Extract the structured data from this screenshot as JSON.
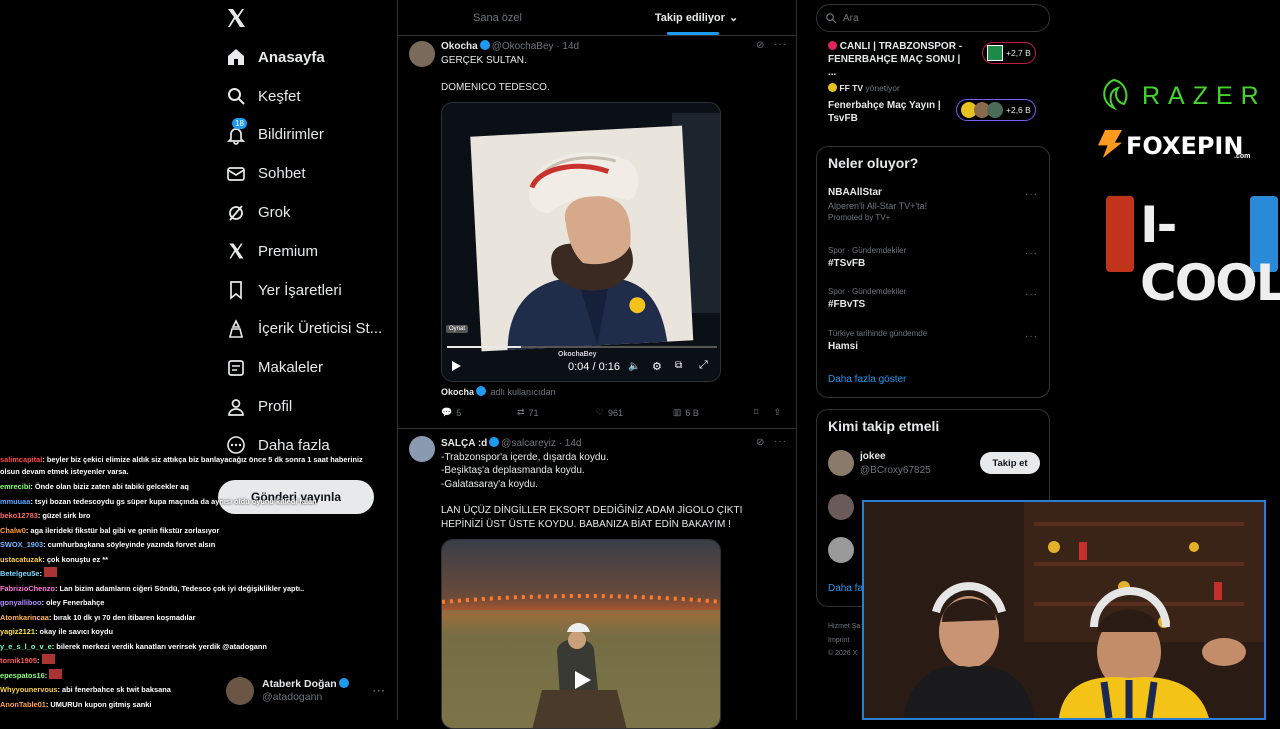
{
  "nav": {
    "items": [
      {
        "label": "Anasayfa",
        "icon": "home-icon"
      },
      {
        "label": "Keşfet",
        "icon": "search-icon"
      },
      {
        "label": "Bildirimler",
        "icon": "bell-icon",
        "badge": "18"
      },
      {
        "label": "Sohbet",
        "icon": "mail-icon"
      },
      {
        "label": "Grok",
        "icon": "grok-icon"
      },
      {
        "label": "Premium",
        "icon": "x-icon"
      },
      {
        "label": "Yer İşaretleri",
        "icon": "bookmark-icon"
      },
      {
        "label": "İçerik Üreticisi St...",
        "icon": "creator-studio-icon"
      },
      {
        "label": "Makaleler",
        "icon": "articles-icon"
      },
      {
        "label": "Profil",
        "icon": "user-icon"
      },
      {
        "label": "Daha fazla",
        "icon": "more-icon"
      }
    ],
    "post_button": "Gönderi yayınla",
    "account": {
      "name": "Ataberk Doğan",
      "handle": "@atadogann"
    }
  },
  "chat": [
    {
      "user": "salimcapital",
      "color": "#ff4a4a",
      "text": ": beyler biz çekici elimize aldık siz attıkça biz banlayacağız önce 5 dk sonra 1 saat haberiniz olsun devam etmek isteyenler varsa."
    },
    {
      "user": "emrecibi",
      "color": "#8cff7a",
      "text": ": Önde olan biziz zaten abi tabiki gelcekler aq"
    },
    {
      "user": "mmuuaa",
      "color": "#5fa8ff",
      "text": ": tsyi bozan tedescoydu gs süper kupa maçında da aynısı oldu oyunu kitledi falan"
    },
    {
      "user": "beko12783",
      "color": "#ff6a6a",
      "text": ": güzel sirk bro"
    },
    {
      "user": "Chalw0",
      "color": "#ff9f40",
      "text": ": aga ilerideki fikstür bal gibi ve genin fikstür zorlasıyor"
    },
    {
      "user": "SWOX_1903",
      "color": "#7ab8ff",
      "text": ": cumhurbaşkana söyleyinde yazında forvet alsın"
    },
    {
      "user": "ustacatuzak",
      "color": "#ffd24a",
      "text": ": çok konuştu ez **"
    },
    {
      "user": "Betelgeu5e",
      "color": "#7ad7ff",
      "text": ":"
    },
    {
      "user": "FabrizioChenzo",
      "color": "#ff7ad7",
      "text": ": Lan bizim adamların ciğeri Söndü, Tedesco çok iyi değişiklikler yaptı.."
    },
    {
      "user": "gonyalliboo",
      "color": "#b58cff",
      "text": ": oley Fenerbahçe"
    },
    {
      "user": "Atomkarincaa",
      "color": "#ffb84a",
      "text": ": bırak 10 dk yı 70 den itibaren koşmadılar"
    },
    {
      "user": "yagiz2121",
      "color": "#ffe14a",
      "text": ": okay ile savıcı koydu"
    },
    {
      "user": "y_e_s_l_o_v_e",
      "color": "#7affc4",
      "text": ": bilerek merkezi verdik kanatları verirsek yerdik @atadogann"
    },
    {
      "user": "tornik1905",
      "color": "#ff5a5a",
      "text": ":"
    },
    {
      "user": "epespatos16",
      "color": "#8cff7a",
      "text": ":"
    },
    {
      "user": "Whyyounervous",
      "color": "#ffd24a",
      "text": ": abi fenerbahce sk twit baksana"
    },
    {
      "user": "AnonTable01",
      "color": "#ffa24a",
      "text": ": UMURUn kupon gitmiş sanki"
    }
  ],
  "feed": {
    "tabs": [
      "Sana özel",
      "Takip ediliyor"
    ],
    "tweet1": {
      "name": "Okocha",
      "handle": "@OkochaBey",
      "time": "· 14d",
      "text1": "GERÇEK SULTAN.",
      "text2": "DOMENICO TEDESCO.",
      "video": {
        "watermark": "OkochaBey",
        "time": "0:04 / 0:16",
        "play_tooltip": "Oynat"
      },
      "source_name": "Okocha",
      "source_note": "adlı kullanıcıdan",
      "replies": "5",
      "reposts": "71",
      "likes": "961",
      "views": "6 B"
    },
    "tweet2": {
      "name": "SALÇA :d",
      "handle": "@salcareyiz",
      "time": "· 14d",
      "lines": [
        "-Trabzonspor'a içerde, dışarda koydu.",
        "-Beşiktaş'a deplasmanda koydu.",
        "-Galatasaray'a koydu."
      ],
      "text2": "LAN ÜÇÜZ DİNGİLLER EKSORT DEDİĞİNİZ ADAM JİGOLO ÇIKTI HEPİNİZİ ÜST ÜSTE KOYDU. BABANIZA BİAT EDİN BAKAYIM !"
    }
  },
  "right": {
    "search_placeholder": "Ara",
    "live1": {
      "title": "CANLI | TRABZONSPOR - FENERBAHÇE MAÇ SONU | ...",
      "count": "+2,7 B"
    },
    "live2": {
      "host": "FF TV",
      "role": "yönetiyor",
      "title": "Fenerbahçe Maç Yayın | TsvFB",
      "count": "+2,6 B"
    },
    "trends_title": "Neler oluyor?",
    "trends": [
      {
        "cat": "",
        "name": "NBAAllStar",
        "desc": "Alperen'li All-Star TV+'ta!",
        "promo": "Promoted by TV+"
      },
      {
        "cat": "Spor · Gündemdekiler",
        "name": "#TSvFB"
      },
      {
        "cat": "Spor · Gündemdekiler",
        "name": "#FBvTS"
      },
      {
        "cat": "Türkiye tarihinde gündemde",
        "name": "Hamsi"
      }
    ],
    "show_more": "Daha fazla göster",
    "who_title": "Kimi takip etmeli",
    "suggest": {
      "name": "jokee",
      "handle": "@BCroxy67825",
      "button": "Takip et"
    },
    "who_more": "Daha fa",
    "footer": [
      "Hizmet Şa",
      "Imprint",
      "© 2026 X"
    ]
  },
  "sponsors": [
    "RAZER",
    "FOXEPIN",
    ".com",
    "I-COOL"
  ],
  "colors": {
    "accent": "#1d9bf0",
    "razer": "#44d62c",
    "foxepin": "#ff9a1f",
    "icool": "#e8e8e8"
  }
}
